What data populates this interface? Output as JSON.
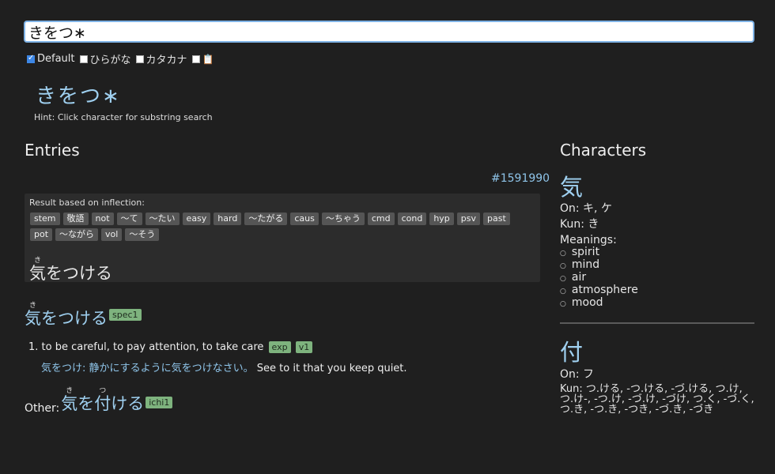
{
  "search": {
    "value": "きをつ∗"
  },
  "modes": [
    {
      "label": "Default",
      "checked": true
    },
    {
      "label": "ひらがな",
      "checked": false
    },
    {
      "label": "カタカナ",
      "checked": false
    },
    {
      "label": "",
      "checked": false,
      "icon": "clipboard-icon"
    }
  ],
  "query_display": "きをつ∗",
  "hint": "Hint: Click character for substring search",
  "entries": {
    "title": "Entries",
    "entry_id": "#1591990",
    "inflection": {
      "label": "Result based on inflection:",
      "tags": [
        "stem",
        "敬語",
        "not",
        "〜て",
        "〜たい",
        "easy",
        "hard",
        "〜たがる",
        "caus",
        "〜ちゃう",
        "cmd",
        "cond",
        "hyp",
        "psv",
        "past",
        "pot",
        "〜ながら",
        "vol",
        "〜そう"
      ],
      "word_kanji": "気",
      "word_reading": "き",
      "word_rest": "をつける"
    },
    "headword": {
      "kanji": "気",
      "reading": "き",
      "rest": "をつける",
      "badge": "spec1"
    },
    "sense": {
      "number": "1.",
      "gloss": "to be careful, to pay attention, to take care",
      "tags": [
        "exp",
        "v1"
      ]
    },
    "example": {
      "ja": "気をつけ: 静かにするように気をつけなさい。",
      "en": "See to it that you keep quiet."
    },
    "other": {
      "label": "Other:",
      "k1": "気",
      "r1": "き",
      "mid": "を",
      "k2": "付",
      "r2": "つ",
      "rest": "ける",
      "badge": "ichi1"
    }
  },
  "characters": {
    "title": "Characters",
    "items": [
      {
        "char": "気",
        "on": "On: キ, ケ",
        "kun": "Kun: き",
        "meanings_label": "Meanings:",
        "meanings": [
          "spirit",
          "mind",
          "air",
          "atmosphere",
          "mood"
        ]
      },
      {
        "char": "付",
        "on": "On: フ",
        "kun": "Kun: つ.ける, -つ.ける, -づ.ける, つ.け, つ.け-, -つ.け, -づ.け, -づけ, つ.く, -づ.く, つ.き, -つ.き, -つき, -づ.き, -づき"
      }
    ]
  }
}
